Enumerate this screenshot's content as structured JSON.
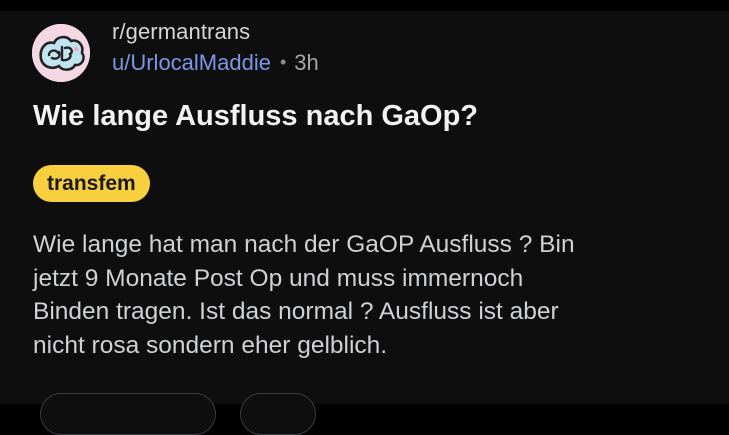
{
  "post": {
    "subreddit": "r/germantrans",
    "author": "u/UrlocalMaddie",
    "separator": "•",
    "time": "3h",
    "title": "Wie lange Ausfluss nach GaOp?",
    "flair": "transfem",
    "body_lines": [
      "Wie lange hat man nach der GaOP Ausfluss ? Bin",
      "jetzt 9 Monate Post Op und muss immernoch",
      "Binden tragen. Ist das normal ? Ausfluss ist aber",
      "nicht rosa sondern eher gelblich."
    ]
  },
  "avatar": {
    "icon": "subreddit-community-icon"
  },
  "colors": {
    "background": "#0e0e0f",
    "username": "#7d97e6",
    "flair_bg": "#f8cf3f",
    "avatar_bg": "#f3d7e3"
  }
}
